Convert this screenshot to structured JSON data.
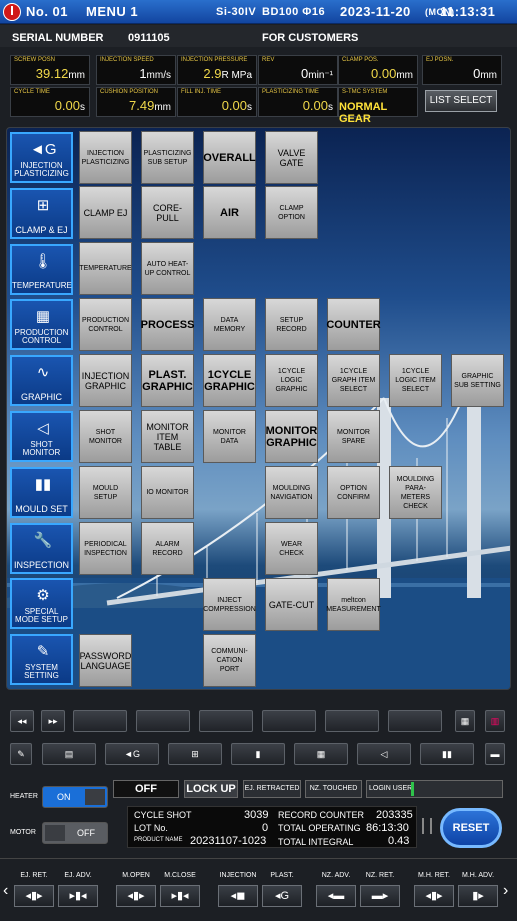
{
  "top": {
    "machine": "No. 01",
    "menu": "MENU 1",
    "model": "Si-30IV",
    "screw": "BD100 Φ16",
    "date": "2023-11-20",
    "dow": "(MON)",
    "time": "11:13:31"
  },
  "header": {
    "serial_label": "SERIAL NUMBER",
    "serial": "0911105",
    "customer": "FOR CUSTOMERS"
  },
  "stats": [
    {
      "label": "SCREW POSN",
      "value": "39.12",
      "unit": "mm"
    },
    {
      "label": "INJECTION SPEED",
      "value": "1",
      "unit": "mm/s"
    },
    {
      "label": "INJECTION PRESSURE",
      "value": "2.9",
      "unit": "R MPa"
    },
    {
      "label": "REV",
      "value": "0",
      "unit": "min⁻¹"
    },
    {
      "label": "CLAMP POS.",
      "value": "0.00",
      "unit": "mm"
    },
    {
      "label": "EJ POSN.",
      "value": "0",
      "unit": "mm"
    },
    {
      "label": "CYCLE TIME",
      "value": "0.00",
      "unit": "s"
    },
    {
      "label": "CUSHION POSITION",
      "value": "7.49",
      "unit": "mm"
    },
    {
      "label": "FILL INJ. TIME",
      "value": "0.00",
      "unit": "s"
    },
    {
      "label": "PLASTICIZING TIME",
      "value": "0.00",
      "unit": "s"
    },
    {
      "label": "S-TMC SYSTEM",
      "value": "NORMAL GEAR",
      "unit": ""
    }
  ],
  "list_select": "LIST SELECT",
  "side": [
    {
      "label": "INJECTION PLASTICIZING",
      "icon": "◄G"
    },
    {
      "label": "CLAMP & EJ",
      "icon": "⊞"
    },
    {
      "label": "TEMPERATURE",
      "icon": "🌡"
    },
    {
      "label": "PRODUCTION CONTROL",
      "icon": "▦"
    },
    {
      "label": "GRAPHIC",
      "icon": "∿"
    },
    {
      "label": "SHOT MONITOR",
      "icon": "◁"
    },
    {
      "label": "MOULD SET",
      "icon": "▮▮"
    },
    {
      "label": "INSPECTION",
      "icon": "🔧"
    },
    {
      "label": "SPECIAL MODE SETUP",
      "icon": "⚙"
    },
    {
      "label": "SYSTEM SETTING",
      "icon": "✎"
    }
  ],
  "grid": {
    "injection_plasticizing": "INJECTION PLASTICIZING",
    "plast_sub": "PLASTICIZING SUB SETUP",
    "overall": "OVERALL",
    "valve_gate": "VALVE GATE",
    "clamp_ej": "CLAMP  EJ",
    "core_pull": "CORE-PULL",
    "air": "AIR",
    "clamp_option": "CLAMP OPTION",
    "temperature": "TEMPERATURE",
    "auto_heat": "AUTO HEAT-UP CONTROL",
    "production_control": "PRODUCTION CONTROL",
    "process": "PROCESS",
    "data_memory": "DATA MEMORY",
    "setup_record": "SETUP RECORD",
    "counter": "COUNTER",
    "injection_graphic": "INJECTION GRAPHIC",
    "plast_graphic": "PLAST. GRAPHIC",
    "cycle_graphic": "1CYCLE GRAPHIC",
    "logic_graphic": "1CYCLE LOGIC GRAPHIC",
    "graph_item": "1CYCLE GRAPH ITEM SELECT",
    "logic_item": "1CYCLE LOGIC ITEM SELECT",
    "graphic_sub": "GRAPHIC SUB SETTING",
    "shot_monitor": "SHOT MONITOR",
    "monitor_item": "MONITOR ITEM TABLE",
    "monitor_data": "MONITOR DATA",
    "monitor_graphic": "MONITOR GRAPHIC",
    "monitor_spare": "MONITOR SPARE",
    "mould_setup": "MOULD SETUP",
    "io_monitor": "IO MONITOR",
    "moulding_nav": "MOULDING NAVIGATION",
    "option_confirm": "OPTION CONFIRM",
    "moulding_check": "MOULDING PARA-METERS CHECK",
    "periodical": "PERIODICAL INSPECTION",
    "alarm_record": "ALARM RECORD",
    "wear_check": "WEAR CHECK",
    "inject_comp": "INJECT COMPRESSION",
    "gate_cut": "GATE-CUT",
    "meltcon": "meltcon MEASUREMENT",
    "password": "PASSWORD LANGUAGE",
    "comm_port": "COMMUNI-CATION PORT"
  },
  "status": {
    "off": "OFF",
    "lockup": "LOCK UP",
    "ej_retracted": "EJ. RETRACTED",
    "nz_touched": "NZ. TOUCHED",
    "login": "LOGIN USER"
  },
  "heater": {
    "label": "HEATER",
    "state": "ON"
  },
  "motor": {
    "label": "MOTOR",
    "state": "OFF"
  },
  "info": {
    "cycle_shot_l": "CYCLE SHOT",
    "cycle_shot": "3039",
    "lot_l": "LOT No.",
    "lot": "0",
    "product_l": "PRODUCT NAME",
    "product": "20231107-1023",
    "record_l": "RECORD COUNTER",
    "record": "203335",
    "total_op_l": "TOTAL OPERATING",
    "total_op": "86:13:30",
    "total_int_l": "TOTAL INTEGRAL",
    "total_int": "0.43"
  },
  "reset": "RESET",
  "bottom": [
    "EJ. RET.",
    "EJ. ADV.",
    "M.OPEN",
    "M.CLOSE",
    "INJECTION",
    "PLAST.",
    "NZ. ADV.",
    "NZ. RET.",
    "M.H. RET.",
    "M.H. ADV."
  ]
}
